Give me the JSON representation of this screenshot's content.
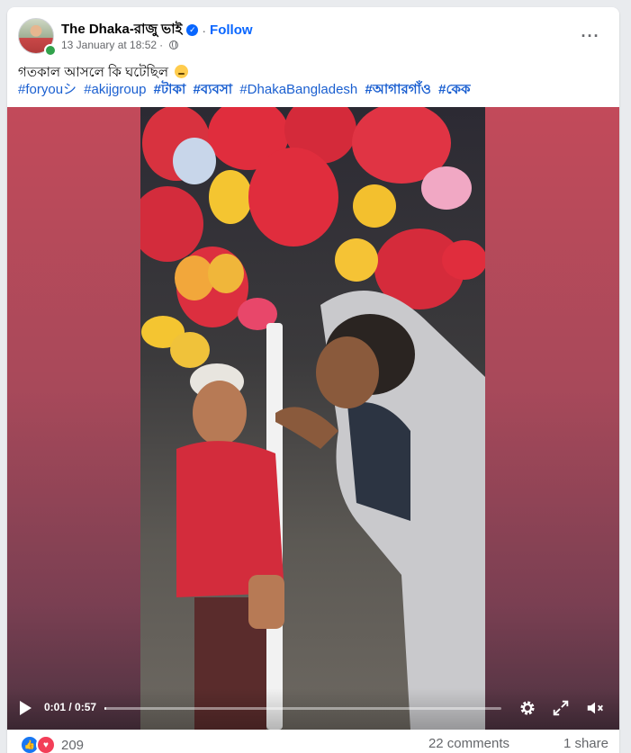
{
  "post": {
    "author": "The Dhaka-রাজু ভাই",
    "verified_icon": "verified-badge-icon",
    "follow_label": "Follow",
    "separator": "·",
    "date": "13 January at 18:52",
    "privacy_icon": "globe-icon",
    "more_icon": "···",
    "caption": "গতকাল আসলে কি ঘটেছিল",
    "hashtags": [
      "#foryouシ",
      "#akijgroup",
      "#টাকা",
      "#ব্যবসা",
      "#DhakaBangladesh",
      "#আগারগাঁও",
      "#কেক"
    ]
  },
  "video": {
    "current_time": "0:01 / 0:57",
    "progress_fraction": 0.005,
    "icons": [
      "play-icon",
      "settings-gear-icon",
      "fullscreen-icon",
      "volume-muted-icon"
    ]
  },
  "footer": {
    "reaction_count": "209",
    "comments": "22 comments",
    "shares": "1 share",
    "reaction_icons": [
      "like-icon",
      "love-icon"
    ]
  },
  "colors": {
    "accent": "#0866ff",
    "hashtag": "#1a5fd0",
    "like": "#1877f2",
    "love": "#f33e58",
    "online": "#31a24c"
  }
}
